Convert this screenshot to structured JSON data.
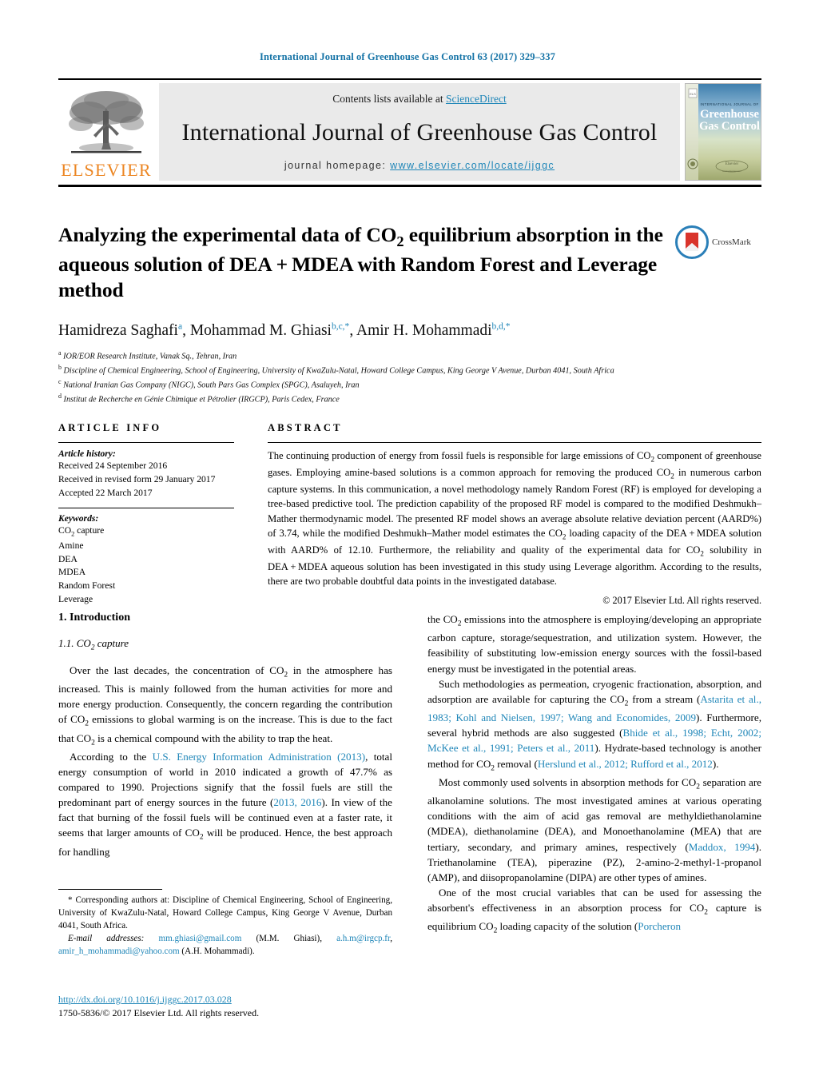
{
  "running_head": "International Journal of Greenhouse Gas Control 63 (2017) 329–337",
  "masthead": {
    "contents_prefix": "Contents lists available at ",
    "sciencedirect": "ScienceDirect",
    "journal_title": "International Journal of Greenhouse Gas Control",
    "homepage_prefix": "journal homepage:",
    "homepage_url": "www.elsevier.com/locate/ijggc",
    "publisher": "ELSEVIER",
    "cover": {
      "line1": "INTERNATIONAL JOURNAL OF",
      "line2": "Greenhouse",
      "line3": "Gas Control"
    }
  },
  "article": {
    "title": "Analyzing the experimental data of CO2 equilibrium absorption in the aqueous solution of DEA + MDEA with Random Forest and Leverage method",
    "crossmark_label": "CrossMark",
    "authors": [
      {
        "name": "Hamidreza Saghafi",
        "marks": "a"
      },
      {
        "name": "Mohammad M. Ghiasi",
        "marks": "b,c,*"
      },
      {
        "name": "Amir H. Mohammadi",
        "marks": "b,d,*"
      }
    ],
    "affiliations": [
      {
        "mark": "a",
        "text": "IOR/EOR Research Institute, Vanak Sq., Tehran, Iran"
      },
      {
        "mark": "b",
        "text": "Discipline of Chemical Engineering, School of Engineering, University of KwaZulu-Natal, Howard College Campus, King George V Avenue, Durban 4041, South Africa"
      },
      {
        "mark": "c",
        "text": "National Iranian Gas Company (NIGC), South Pars Gas Complex (SPGC), Asaluyeh, Iran"
      },
      {
        "mark": "d",
        "text": "Institut de Recherche en Génie Chimique et Pétrolier (IRGCP), Paris Cedex, France"
      }
    ]
  },
  "article_info": {
    "heading": "ARTICLE INFO",
    "history_label": "Article history:",
    "history": [
      "Received 24 September 2016",
      "Received in revised form 29 January 2017",
      "Accepted 22 March 2017"
    ],
    "keywords_label": "Keywords:",
    "keywords": [
      "CO2 capture",
      "Amine",
      "DEA",
      "MDEA",
      "Random Forest",
      "Leverage"
    ]
  },
  "abstract": {
    "heading": "ABSTRACT",
    "text": "The continuing production of energy from fossil fuels is responsible for large emissions of CO2 component of greenhouse gases. Employing amine-based solutions is a common approach for removing the produced CO2 in numerous carbon capture systems. In this communication, a novel methodology namely Random Forest (RF) is employed for developing a tree-based predictive tool. The prediction capability of the proposed RF model is compared to the modified Deshmukh–Mather thermodynamic model. The presented RF model shows an average absolute relative deviation percent (AARD%) of 3.74, while the modified Deshmukh–Mather model estimates the CO2 loading capacity of the DEA + MDEA solution with AARD% of 12.10. Furthermore, the reliability and quality of the experimental data for CO2 solubility in DEA + MDEA aqueous solution has been investigated in this study using Leverage algorithm. According to the results, there are two probable doubtful data points in the investigated database.",
    "copyright": "© 2017 Elsevier Ltd. All rights reserved."
  },
  "body": {
    "section_1": "1. Introduction",
    "subsection_1_1": "1.1. CO2 capture",
    "left_para_1": "Over the last decades, the concentration of CO2 in the atmosphere has increased. This is mainly followed from the human activities for more and more energy production. Consequently, the concern regarding the contribution of CO2 emissions to global warming is on the increase. This is due to the fact that CO2 is a chemical compound with the ability to trap the heat.",
    "left_para_2_a": "According to the ",
    "left_para_2_ref1": "U.S. Energy Information Administration (2013)",
    "left_para_2_b": ", total energy consumption of world in 2010 indicated a growth of 47.7% as compared to 1990. Projections signify that the fossil fuels are still the predominant part of energy sources in the future (",
    "left_para_2_ref2": "2013, 2016",
    "left_para_2_c": "). In view of the fact that burning of the fossil fuels will be continued even at a faster rate, it seems that larger amounts of CO2 will be produced. Hence, the best approach for handling",
    "right_para_1": "the CO2 emissions into the atmosphere is employing/developing an appropriate carbon capture, storage/sequestration, and utilization system. However, the feasibility of substituting low-emission energy sources with the fossil-based energy must be investigated in the potential areas.",
    "right_para_2_a": "Such methodologies as permeation, cryogenic fractionation, absorption, and adsorption are available for capturing the CO2 from a stream (",
    "right_para_2_ref1": "Astarita et al., 1983; Kohl and Nielsen, 1997; Wang and Economides, 2009",
    "right_para_2_b": "). Furthermore, several hybrid methods are also suggested (",
    "right_para_2_ref2": "Bhide et al., 1998; Echt, 2002; McKee et al., 1991; Peters et al., 2011",
    "right_para_2_c": "). Hydrate-based technology is another method for CO2 removal (",
    "right_para_2_ref3": "Herslund et al., 2012; Rufford et al., 2012",
    "right_para_2_d": ").",
    "right_para_3_a": "Most commonly used solvents in absorption methods for CO2 separation are alkanolamine solutions. The most investigated amines at various operating conditions with the aim of acid gas removal are methyldiethanolamine (MDEA), diethanolamine (DEA), and Monoethanolamine (MEA) that are tertiary, secondary, and primary amines, respectively (",
    "right_para_3_ref": "Maddox, 1994",
    "right_para_3_b": "). Triethanolamine (TEA), piperazine (PZ), 2-amino-2-methyl-1-propanol (AMP), and diisopropanolamine (DIPA) are other types of amines.",
    "right_para_4_a": "One of the most crucial variables that can be used for assessing the absorbent's effectiveness in an absorption process for CO2 capture is equilibrium CO2 loading capacity of the solution (",
    "right_para_4_ref": "Porcheron"
  },
  "footnotes": {
    "corresponding": "* Corresponding authors at: Discipline of Chemical Engineering, School of Engineering, University of KwaZulu-Natal, Howard College Campus, King George V Avenue, Durban 4041, South Africa.",
    "email_label": "E-mail addresses:",
    "emails": [
      {
        "address": "mm.ghiasi@gmail.com",
        "owner": "(M.M. Ghiasi)"
      },
      {
        "address": "a.h.m@irgcp.fr",
        "owner": ""
      },
      {
        "address": "amir_h_mohammadi@yahoo.com",
        "owner": "(A.H. Mohammadi)."
      }
    ],
    "doi": "http://dx.doi.org/10.1016/j.ijggc.2017.03.028",
    "issn": "1750-5836/© 2017 Elsevier Ltd. All rights reserved."
  },
  "colors": {
    "link": "#1f86b8",
    "elsevier_orange": "#ec8623",
    "band_gray": "#eaeaea"
  }
}
